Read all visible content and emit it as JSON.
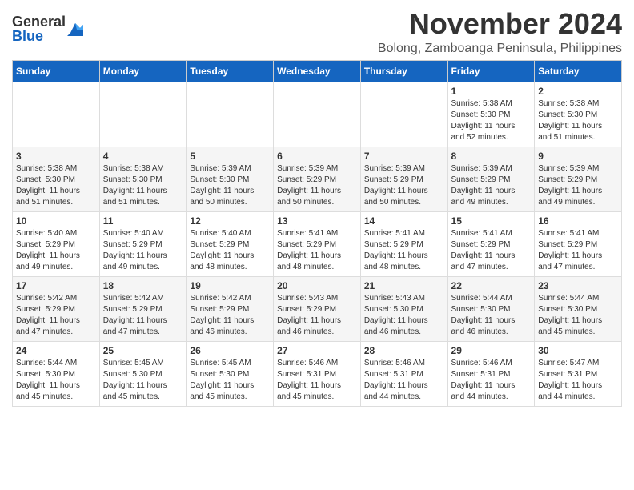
{
  "header": {
    "logo_general": "General",
    "logo_blue": "Blue",
    "month_title": "November 2024",
    "location": "Bolong, Zamboanga Peninsula, Philippines"
  },
  "calendar": {
    "days_of_week": [
      "Sunday",
      "Monday",
      "Tuesday",
      "Wednesday",
      "Thursday",
      "Friday",
      "Saturday"
    ],
    "weeks": [
      [
        {
          "day": "",
          "info": ""
        },
        {
          "day": "",
          "info": ""
        },
        {
          "day": "",
          "info": ""
        },
        {
          "day": "",
          "info": ""
        },
        {
          "day": "",
          "info": ""
        },
        {
          "day": "1",
          "info": "Sunrise: 5:38 AM\nSunset: 5:30 PM\nDaylight: 11 hours\nand 52 minutes."
        },
        {
          "day": "2",
          "info": "Sunrise: 5:38 AM\nSunset: 5:30 PM\nDaylight: 11 hours\nand 51 minutes."
        }
      ],
      [
        {
          "day": "3",
          "info": "Sunrise: 5:38 AM\nSunset: 5:30 PM\nDaylight: 11 hours\nand 51 minutes."
        },
        {
          "day": "4",
          "info": "Sunrise: 5:38 AM\nSunset: 5:30 PM\nDaylight: 11 hours\nand 51 minutes."
        },
        {
          "day": "5",
          "info": "Sunrise: 5:39 AM\nSunset: 5:30 PM\nDaylight: 11 hours\nand 50 minutes."
        },
        {
          "day": "6",
          "info": "Sunrise: 5:39 AM\nSunset: 5:29 PM\nDaylight: 11 hours\nand 50 minutes."
        },
        {
          "day": "7",
          "info": "Sunrise: 5:39 AM\nSunset: 5:29 PM\nDaylight: 11 hours\nand 50 minutes."
        },
        {
          "day": "8",
          "info": "Sunrise: 5:39 AM\nSunset: 5:29 PM\nDaylight: 11 hours\nand 49 minutes."
        },
        {
          "day": "9",
          "info": "Sunrise: 5:39 AM\nSunset: 5:29 PM\nDaylight: 11 hours\nand 49 minutes."
        }
      ],
      [
        {
          "day": "10",
          "info": "Sunrise: 5:40 AM\nSunset: 5:29 PM\nDaylight: 11 hours\nand 49 minutes."
        },
        {
          "day": "11",
          "info": "Sunrise: 5:40 AM\nSunset: 5:29 PM\nDaylight: 11 hours\nand 49 minutes."
        },
        {
          "day": "12",
          "info": "Sunrise: 5:40 AM\nSunset: 5:29 PM\nDaylight: 11 hours\nand 48 minutes."
        },
        {
          "day": "13",
          "info": "Sunrise: 5:41 AM\nSunset: 5:29 PM\nDaylight: 11 hours\nand 48 minutes."
        },
        {
          "day": "14",
          "info": "Sunrise: 5:41 AM\nSunset: 5:29 PM\nDaylight: 11 hours\nand 48 minutes."
        },
        {
          "day": "15",
          "info": "Sunrise: 5:41 AM\nSunset: 5:29 PM\nDaylight: 11 hours\nand 47 minutes."
        },
        {
          "day": "16",
          "info": "Sunrise: 5:41 AM\nSunset: 5:29 PM\nDaylight: 11 hours\nand 47 minutes."
        }
      ],
      [
        {
          "day": "17",
          "info": "Sunrise: 5:42 AM\nSunset: 5:29 PM\nDaylight: 11 hours\nand 47 minutes."
        },
        {
          "day": "18",
          "info": "Sunrise: 5:42 AM\nSunset: 5:29 PM\nDaylight: 11 hours\nand 47 minutes."
        },
        {
          "day": "19",
          "info": "Sunrise: 5:42 AM\nSunset: 5:29 PM\nDaylight: 11 hours\nand 46 minutes."
        },
        {
          "day": "20",
          "info": "Sunrise: 5:43 AM\nSunset: 5:29 PM\nDaylight: 11 hours\nand 46 minutes."
        },
        {
          "day": "21",
          "info": "Sunrise: 5:43 AM\nSunset: 5:30 PM\nDaylight: 11 hours\nand 46 minutes."
        },
        {
          "day": "22",
          "info": "Sunrise: 5:44 AM\nSunset: 5:30 PM\nDaylight: 11 hours\nand 46 minutes."
        },
        {
          "day": "23",
          "info": "Sunrise: 5:44 AM\nSunset: 5:30 PM\nDaylight: 11 hours\nand 45 minutes."
        }
      ],
      [
        {
          "day": "24",
          "info": "Sunrise: 5:44 AM\nSunset: 5:30 PM\nDaylight: 11 hours\nand 45 minutes."
        },
        {
          "day": "25",
          "info": "Sunrise: 5:45 AM\nSunset: 5:30 PM\nDaylight: 11 hours\nand 45 minutes."
        },
        {
          "day": "26",
          "info": "Sunrise: 5:45 AM\nSunset: 5:30 PM\nDaylight: 11 hours\nand 45 minutes."
        },
        {
          "day": "27",
          "info": "Sunrise: 5:46 AM\nSunset: 5:31 PM\nDaylight: 11 hours\nand 45 minutes."
        },
        {
          "day": "28",
          "info": "Sunrise: 5:46 AM\nSunset: 5:31 PM\nDaylight: 11 hours\nand 44 minutes."
        },
        {
          "day": "29",
          "info": "Sunrise: 5:46 AM\nSunset: 5:31 PM\nDaylight: 11 hours\nand 44 minutes."
        },
        {
          "day": "30",
          "info": "Sunrise: 5:47 AM\nSunset: 5:31 PM\nDaylight: 11 hours\nand 44 minutes."
        }
      ]
    ]
  }
}
